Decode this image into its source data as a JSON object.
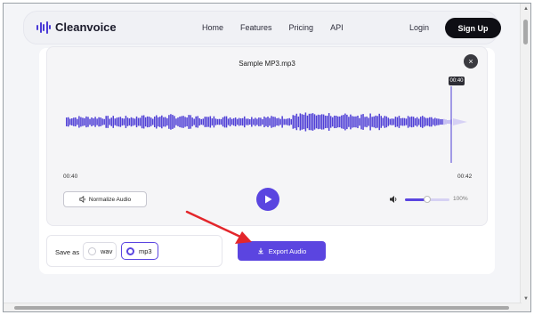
{
  "brand": {
    "name": "Cleanvoice"
  },
  "nav": {
    "links": [
      "Home",
      "Features",
      "Pricing",
      "API"
    ],
    "login": "Login",
    "signup": "Sign Up"
  },
  "player": {
    "filename": "Sample MP3.mp3",
    "close_icon": "×",
    "playhead_time": "00:40",
    "time_start": "00:40",
    "time_end": "00:42",
    "normalize_label": "Normalize Audio",
    "volume_percent": "100%",
    "volume_level": 0.5
  },
  "export": {
    "save_as_label": "Save as",
    "formats": [
      "wav",
      "mp3"
    ],
    "selected_format": "mp3",
    "export_label": "Export Audio"
  },
  "colors": {
    "accent": "#5a45e0",
    "arrow": "#e3262b",
    "dark": "#0e0e14"
  }
}
